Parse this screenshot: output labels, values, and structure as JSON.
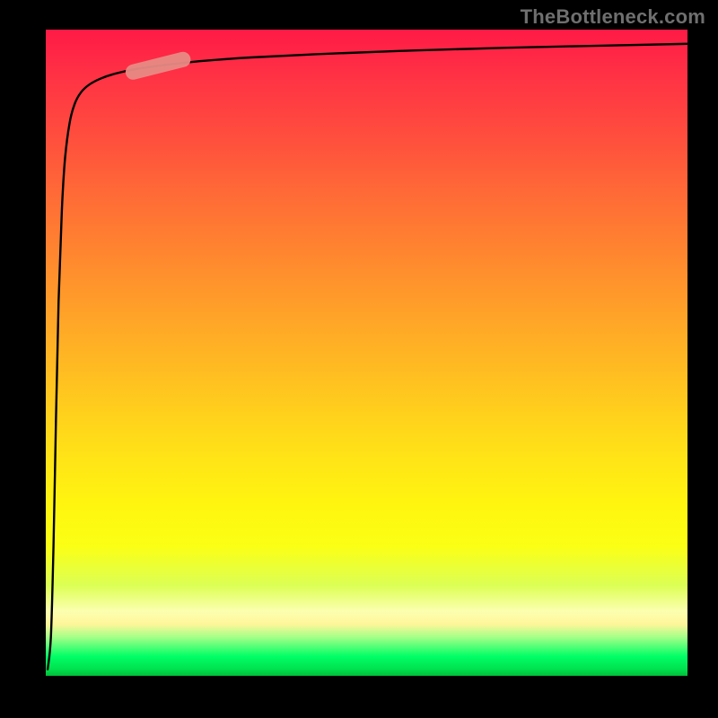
{
  "attribution": "TheBottleneck.com",
  "chart_data": {
    "type": "line",
    "title": "",
    "xlabel": "",
    "ylabel": "",
    "xlim": [
      0,
      100
    ],
    "ylim": [
      0,
      100
    ],
    "grid": false,
    "legend": false,
    "background_gradient": {
      "direction": "vertical_top_to_bottom",
      "stops": [
        {
          "pos": 0.0,
          "color": "#ff1a45"
        },
        {
          "pos": 0.2,
          "color": "#ff5a3a"
        },
        {
          "pos": 0.45,
          "color": "#ffaa27"
        },
        {
          "pos": 0.7,
          "color": "#ffee12"
        },
        {
          "pos": 0.9,
          "color": "#f6ffa0"
        },
        {
          "pos": 0.97,
          "color": "#00ff66"
        },
        {
          "pos": 1.0,
          "color": "#00c038"
        }
      ]
    },
    "series": [
      {
        "name": "curve",
        "color": "#000000",
        "x": [
          0.3,
          0.8,
          1.2,
          1.6,
          2.0,
          2.5,
          3.0,
          3.7,
          4.5,
          5.5,
          6.8,
          8.5,
          10.5,
          13.0,
          16.0,
          20.0,
          25.0,
          32.0,
          42.0,
          55.0,
          72.0,
          100.0
        ],
        "y": [
          1.0,
          6.0,
          20.0,
          40.0,
          58.0,
          72.0,
          80.0,
          85.5,
          88.5,
          90.3,
          91.5,
          92.4,
          93.1,
          93.7,
          94.2,
          94.7,
          95.2,
          95.7,
          96.2,
          96.7,
          97.2,
          97.8
        ]
      }
    ],
    "highlight_segment": {
      "description": "thick_rounded_pink_band_on_curve",
      "color": "#e88a85",
      "center_x": 17.5,
      "center_y": 94.4,
      "length": 8.0,
      "thickness": 2.4
    }
  }
}
